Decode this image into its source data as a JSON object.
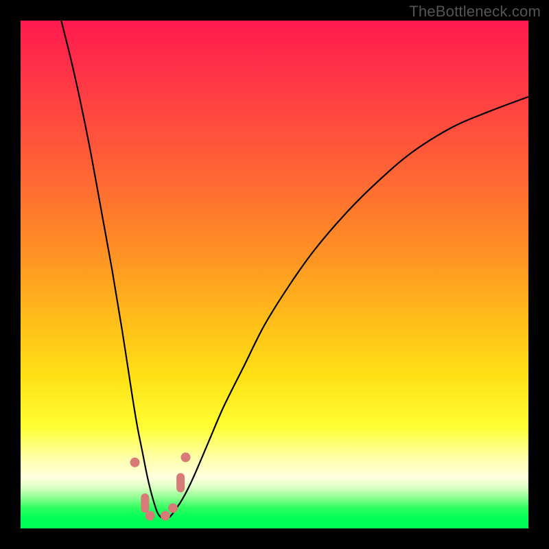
{
  "watermark": "TheBottleneck.com",
  "colors": {
    "frame_bg": "#000000",
    "curve": "#000000",
    "marker": "#d77a78",
    "gradient_top": "#ff1a4d",
    "gradient_mid": "#ffe016",
    "gradient_bottom": "#00ff55"
  },
  "chart_data": {
    "type": "line",
    "title": "",
    "xlabel": "",
    "ylabel": "",
    "xlim": [
      0,
      100
    ],
    "ylim": [
      0,
      100
    ],
    "note": "Axes are unlabeled in the source image. x is expressed as percent of plot width, y as percent of plot height (0 = bottom/green, 100 = top/red). The single curve descends steeply from top-left, bottoms out near x≈27, y≈2, then rises with diminishing slope toward the right edge reaching y≈85.",
    "x": [
      8,
      10,
      12,
      14,
      16,
      18,
      20,
      22,
      23,
      24,
      25,
      26,
      27,
      28,
      29,
      30,
      32,
      34,
      37,
      40,
      44,
      48,
      53,
      58,
      64,
      70,
      77,
      85,
      92,
      100
    ],
    "y": [
      100,
      92,
      83,
      73,
      62,
      51,
      39,
      26,
      20,
      15,
      10,
      6,
      3,
      2,
      2,
      3,
      6,
      10,
      17,
      24,
      32,
      40,
      48,
      55,
      62,
      68,
      74,
      79,
      82,
      85
    ],
    "markers": [
      {
        "shape": "circle",
        "x": 22.5,
        "y": 13
      },
      {
        "shape": "capsule",
        "x": 24.5,
        "y": 5
      },
      {
        "shape": "circle",
        "x": 25.5,
        "y": 2.5
      },
      {
        "shape": "circle",
        "x": 28.5,
        "y": 2.5
      },
      {
        "shape": "circle",
        "x": 30.0,
        "y": 4
      },
      {
        "shape": "capsule",
        "x": 31.5,
        "y": 9
      },
      {
        "shape": "circle",
        "x": 32.5,
        "y": 14
      }
    ]
  }
}
